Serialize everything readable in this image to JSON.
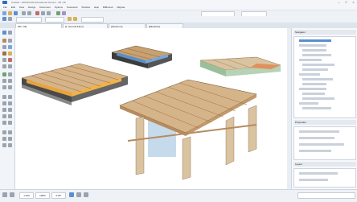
{
  "app": {
    "title": "Untitled - ARCHICAD Educational Version - 3D / All",
    "window_controls": [
      "–",
      "□",
      "×"
    ]
  },
  "menu": [
    "File",
    "Edit",
    "View",
    "Design",
    "Document",
    "Options",
    "Teamwork",
    "Window",
    "Help",
    "BIMcloud",
    "Migrate"
  ],
  "tabs": [
    {
      "label": "[3D / All]"
    },
    {
      "label": "[1. Ground Floor]"
    },
    {
      "label": "[Section A]"
    },
    {
      "label": "[Elevation]"
    }
  ],
  "navigator": {
    "header": "Navigator",
    "panel2_header": "Properties",
    "panel3_header": "Layers"
  },
  "status": {
    "scale": "1:100",
    "zoom": "100%",
    "angle": "0.00°"
  },
  "colors": {
    "wood_light": "#d6b48a",
    "wood_mid": "#b78b5e",
    "insulation": "#e8a33a",
    "dark_slab": "#4a4a4a",
    "accent_blue": "#5a8fd1"
  }
}
